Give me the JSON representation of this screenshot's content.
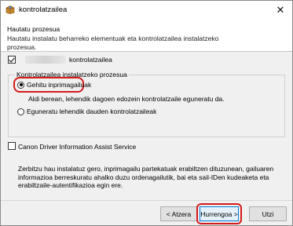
{
  "window": {
    "title": "kontrolatzailea",
    "close_glyph": "✕"
  },
  "header": {
    "title": "Hautatu prozesua",
    "description": "Hautatu instalatu beharreko elementuak eta kontrolatzailea instalatzeko prozesua."
  },
  "driver": {
    "checked": true,
    "label": "kontrolatzailea"
  },
  "install_process": {
    "group_label": "Kontrolatzailea instalatzeko prozesua",
    "options": [
      {
        "label": "Gehitu inprimagailuak",
        "selected": true,
        "description": "Aldi berean, lehendik dagoen edozein kontrolatzaile eguneratu da."
      },
      {
        "label": "Eguneratu lehendik dauden kontrolatzaileak",
        "selected": false
      }
    ]
  },
  "assist_service": {
    "checked": false,
    "label": "Canon Driver Information Assist Service",
    "description": "Zerbitzu hau instalatuz gero, inprimagailu partekatuak erabiltzen dituzunean, gailuaren informazioa berreskuratu ahalko duzu ordenagailutik, bai eta sail-IDen kudeaketa eta erabiltzaile-autentifikazioa egin ere."
  },
  "buttons": {
    "back": "< Atzera",
    "next": "Hurrengoa >",
    "cancel": "Utzi"
  },
  "colors": {
    "highlight_red": "#d61a1a",
    "default_button_border": "#0078d7"
  },
  "icons": {
    "app": "installer-icon",
    "close": "close-icon"
  }
}
